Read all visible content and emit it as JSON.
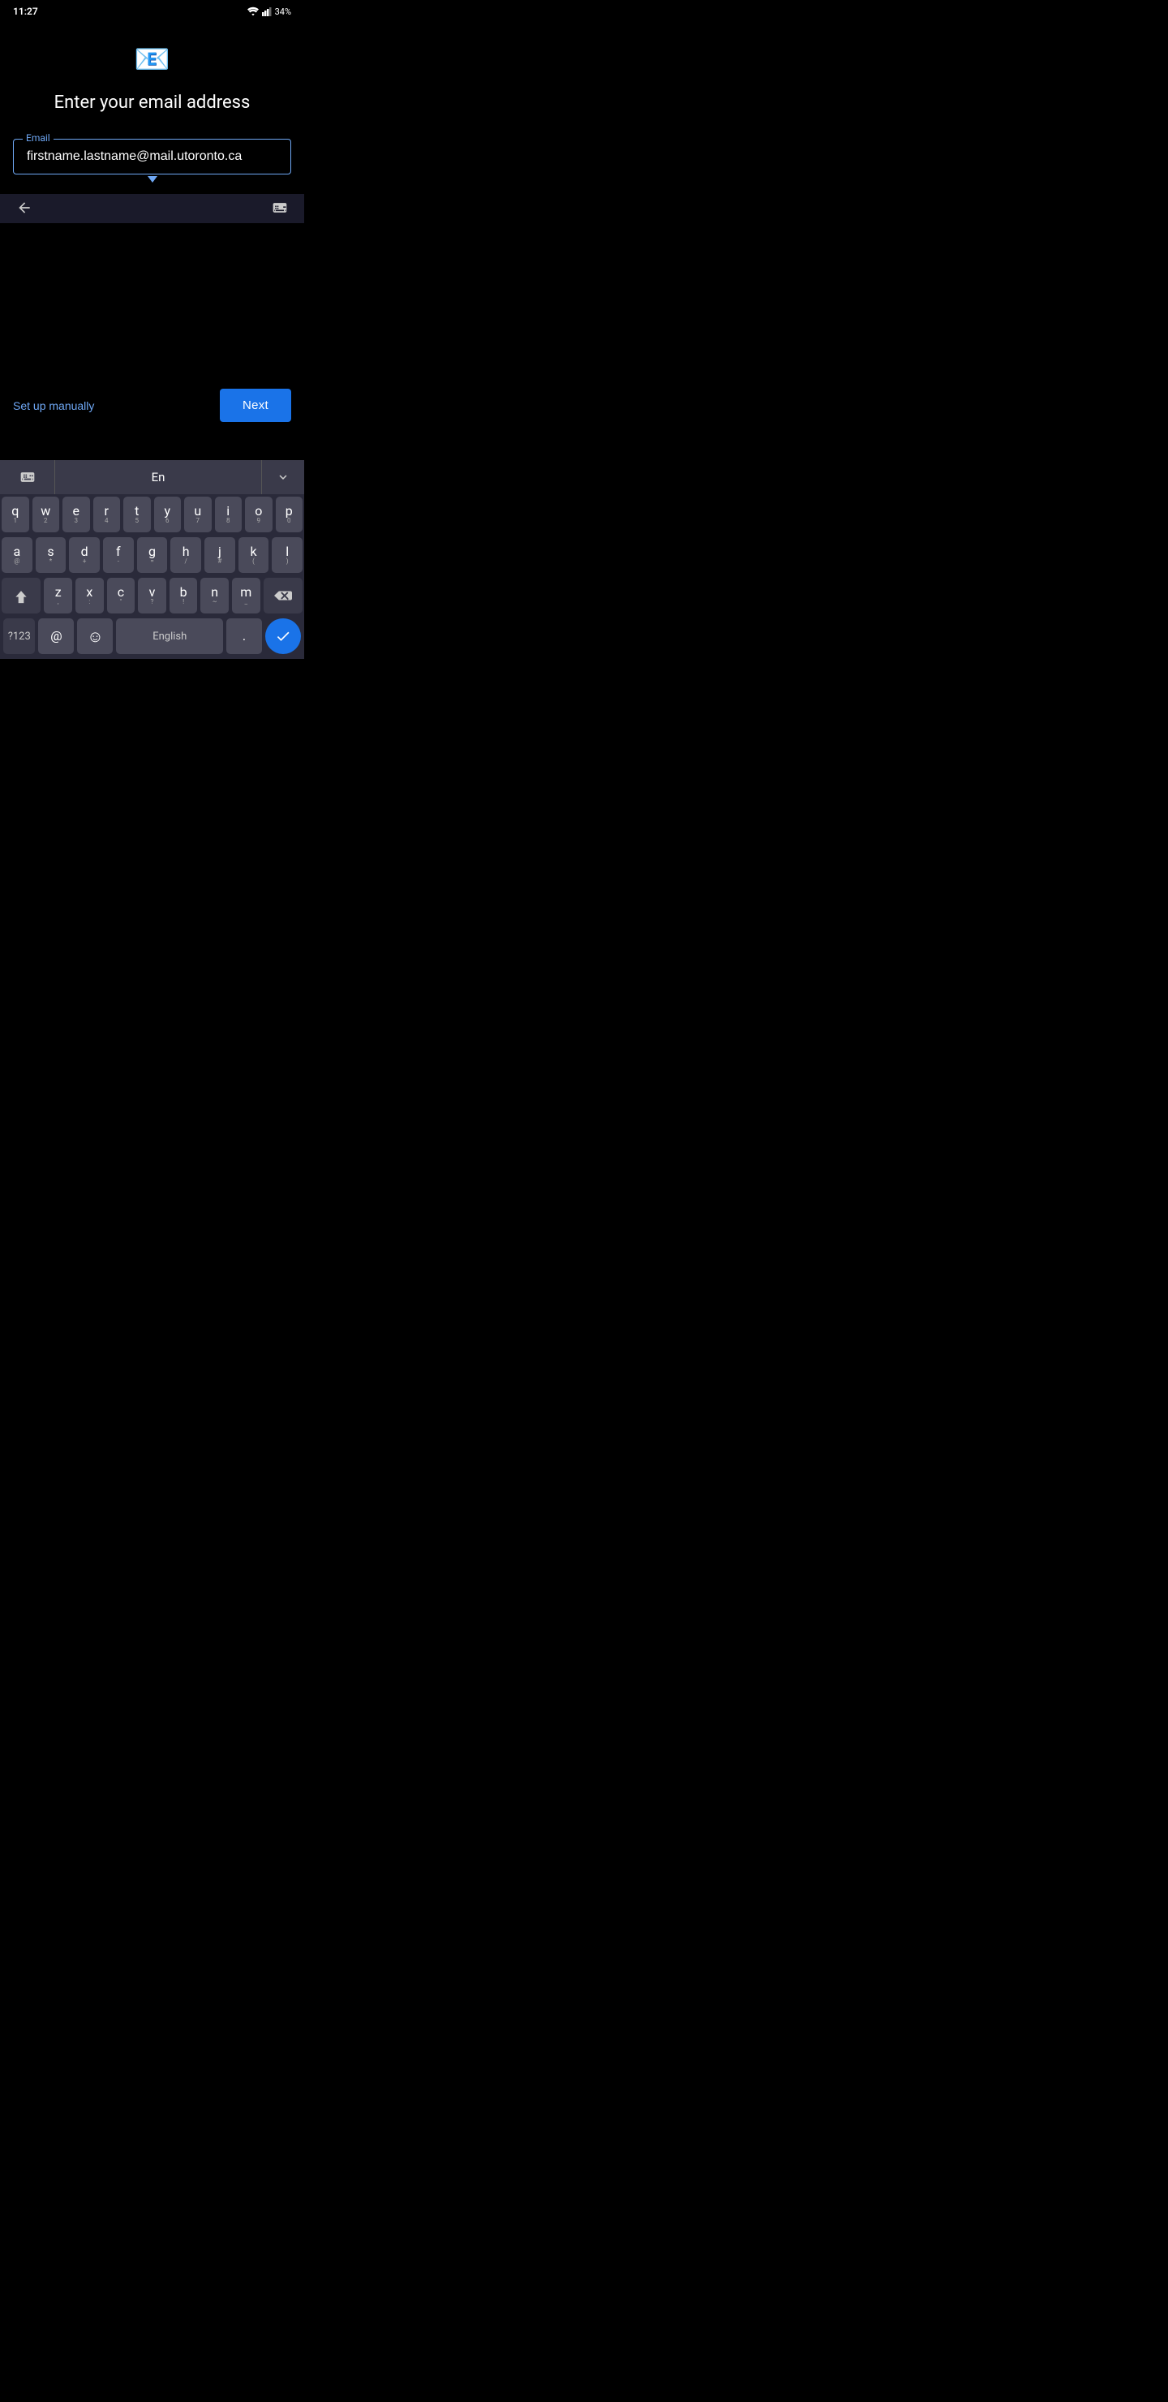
{
  "statusBar": {
    "time": "11:27",
    "battery": "34%",
    "icons": [
      "messenger",
      "snapchat",
      "strava",
      "maps",
      "wifi",
      "signal",
      "battery"
    ]
  },
  "app": {
    "logo": "📧",
    "title": "Enter your email address",
    "emailLabel": "Email",
    "emailValue": "firstname.lastname@mail.utoronto.ca"
  },
  "actions": {
    "setupManually": "Set up manually",
    "next": "Next"
  },
  "keyboard": {
    "lang": "En",
    "spaceLabel": "English",
    "rows": [
      [
        "q",
        "w",
        "e",
        "r",
        "t",
        "y",
        "u",
        "i",
        "o",
        "p"
      ],
      [
        "a",
        "s",
        "d",
        "f",
        "g",
        "h",
        "j",
        "k",
        "l"
      ],
      [
        "z",
        "x",
        "c",
        "v",
        "b",
        "n",
        "m"
      ]
    ],
    "subLabels": {
      "q": "1",
      "w": "2",
      "e": "3",
      "r": "4",
      "t": "5",
      "y": "6",
      "u": "7",
      "i": "8",
      "o": "9",
      "p": "0",
      "a": "@",
      "s": "*",
      "d": "+",
      "f": "-",
      "g": "=",
      "h": "/",
      "j": "#",
      "k": "(",
      "l": ")",
      "z": ",",
      "x": ":",
      "c": "\"",
      "v": "?",
      "b": "!",
      "n": "~",
      "m": "_"
    }
  }
}
